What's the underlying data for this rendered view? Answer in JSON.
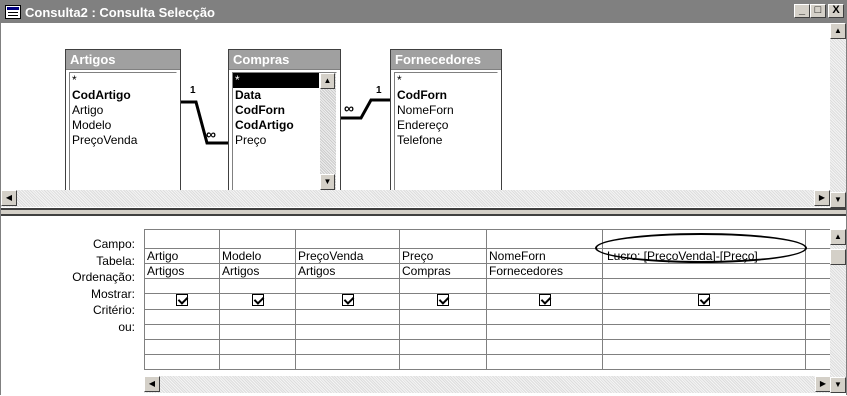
{
  "window": {
    "title": "Consulta2 : Consulta Selecção",
    "minimize": "_",
    "maximize": "□",
    "close": "X"
  },
  "tables": [
    {
      "name": "Artigos",
      "fields": [
        {
          "text": "*",
          "bold": false
        },
        {
          "text": "CodArtigo",
          "bold": true
        },
        {
          "text": "Artigo",
          "bold": false
        },
        {
          "text": "Modelo",
          "bold": false
        },
        {
          "text": "PreçoVenda",
          "bold": false
        }
      ]
    },
    {
      "name": "Compras",
      "fields": [
        {
          "text": "*",
          "bold": false,
          "selected": true
        },
        {
          "text": "Data",
          "bold": true
        },
        {
          "text": "CodForn",
          "bold": true
        },
        {
          "text": "CodArtigo",
          "bold": true
        },
        {
          "text": "Preço",
          "bold": false
        }
      ]
    },
    {
      "name": "Fornecedores",
      "fields": [
        {
          "text": "*",
          "bold": false
        },
        {
          "text": "CodForn",
          "bold": true
        },
        {
          "text": "NomeForn",
          "bold": false
        },
        {
          "text": "Endereço",
          "bold": false
        },
        {
          "text": "Telefone",
          "bold": false
        }
      ]
    }
  ],
  "relationships": [
    {
      "one": "1",
      "many": "∞"
    },
    {
      "one": "1",
      "many": "∞"
    }
  ],
  "grid": {
    "row_labels": [
      "Campo:",
      "Tabela:",
      "Ordenação:",
      "Mostrar:",
      "Critério:",
      "ou:"
    ],
    "columns": [
      {
        "campo": "Artigo",
        "tabela": "Artigos",
        "mostrar": true
      },
      {
        "campo": "Modelo",
        "tabela": "Artigos",
        "mostrar": true
      },
      {
        "campo": "PreçoVenda",
        "tabela": "Artigos",
        "mostrar": true
      },
      {
        "campo": "Preço",
        "tabela": "Compras",
        "mostrar": true
      },
      {
        "campo": "NomeForn",
        "tabela": "Fornecedores",
        "mostrar": true
      },
      {
        "campo": "Lucro: [PreçoVenda]-[Preço]",
        "tabela": "",
        "mostrar": true
      },
      {
        "campo": "",
        "tabela": "",
        "mostrar": false
      }
    ]
  }
}
